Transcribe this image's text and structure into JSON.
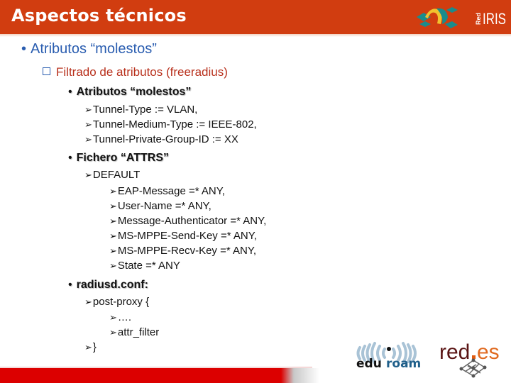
{
  "header": {
    "title": "Aspectos técnicos",
    "logo": {
      "icon": "rediris-logo-icon",
      "text_small": "Red",
      "text_big": "IRIS"
    }
  },
  "colors": {
    "header_bg": "#d13d10",
    "level1_text": "#2a5db0",
    "level2_text": "#b8301c",
    "bottom_bar": "#dc0000"
  },
  "content": {
    "level1": {
      "bullet": "•",
      "text": "Atributos “molestos”"
    },
    "level2": {
      "bullet_icon": "checkbox-square-icon",
      "text": "Filtrado de atributos (freeradius)"
    },
    "sections": [
      {
        "bullet": "•",
        "title": "Atributos “molestos”",
        "items": [
          "Tunnel-Type := VLAN,",
          "Tunnel-Medium-Type := IEEE-802,",
          "Tunnel-Private-Group-ID := XX"
        ]
      },
      {
        "bullet": "•",
        "title": "Fichero “ATTRS”",
        "items": [
          "DEFAULT"
        ],
        "subitems": [
          "EAP-Message =* ANY,",
          "User-Name =* ANY,",
          "Message-Authenticator =* ANY,",
          "MS-MPPE-Send-Key =* ANY,",
          "MS-MPPE-Recv-Key =* ANY,",
          "State =* ANY"
        ]
      },
      {
        "bullet": "•",
        "title": "radiusd.conf:",
        "items": [
          "post-proxy {"
        ],
        "subitems": [
          "….",
          "attr_filter"
        ],
        "closing": "}"
      }
    ],
    "arrow_glyph": "➢"
  },
  "footer": {
    "logos": [
      {
        "name": "eduroam",
        "text_a": "edu",
        "text_b": "roam"
      },
      {
        "name": "red.es",
        "text_a": "red",
        "text_b": "es"
      }
    ]
  }
}
